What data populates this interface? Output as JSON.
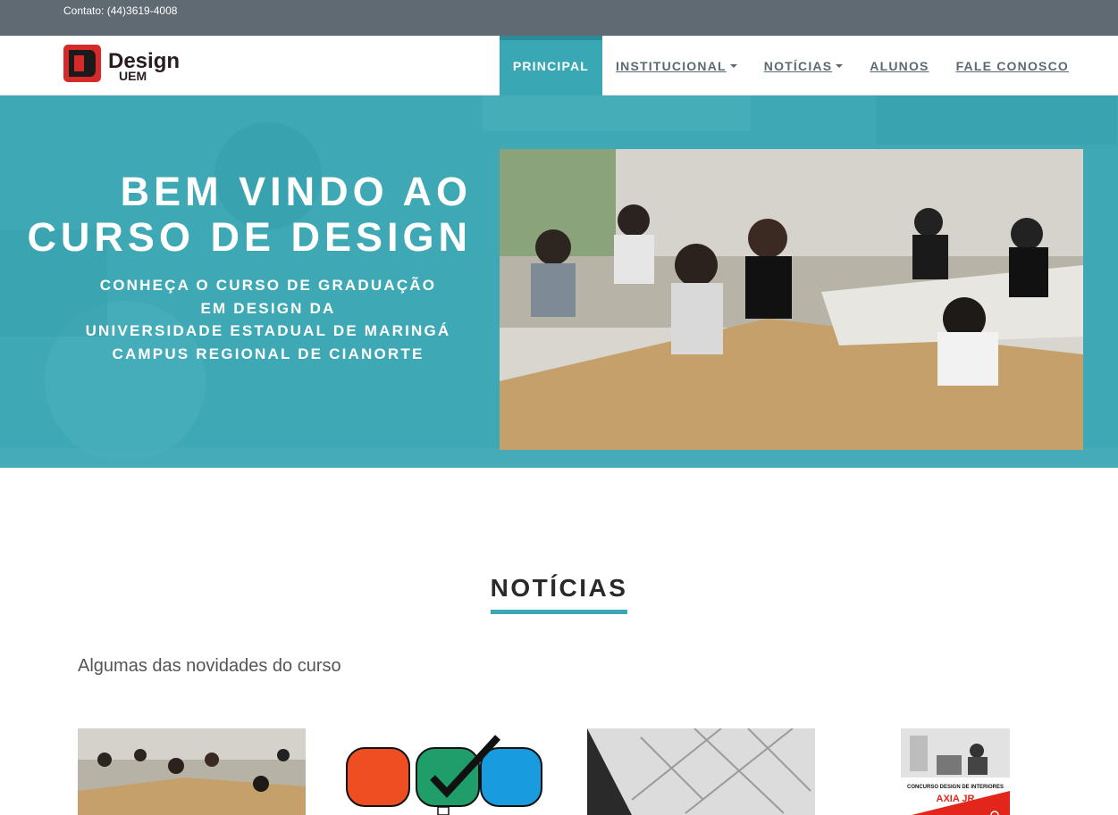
{
  "topbar": {
    "contact": "Contato: (44)3619-4008"
  },
  "logo": {
    "word": "Design",
    "sub": "UEM"
  },
  "nav": {
    "items": [
      {
        "label": "PRINCIPAL",
        "active": true,
        "dropdown": false
      },
      {
        "label": "INSTITUCIONAL ",
        "active": false,
        "dropdown": true
      },
      {
        "label": "NOTÍCIAS ",
        "active": false,
        "dropdown": true
      },
      {
        "label": "ALUNOS",
        "active": false,
        "dropdown": false
      },
      {
        "label": "FALE CONOSCO",
        "active": false,
        "dropdown": false
      }
    ]
  },
  "hero": {
    "title_line1": "BEM VINDO AO",
    "title_line2": "CURSO DE DESIGN",
    "subtitle_lines": [
      "CONHEÇA O CURSO DE GRADUAÇÃO",
      "EM DESIGN DA",
      "UNIVERSIDADE ESTADUAL DE MARINGÁ",
      "CAMPUS REGIONAL DE CIANORTE"
    ]
  },
  "news": {
    "title": "NOTÍCIAS",
    "subtitle": "Algumas das novidades do curso",
    "poster_title": "CONCURSO DESIGN DE INTERIORES",
    "poster_brand": "AXIA JR"
  },
  "colors": {
    "accent": "#3aa8b4",
    "topbar": "#5f6a72",
    "logo_red": "#d62a2a"
  }
}
